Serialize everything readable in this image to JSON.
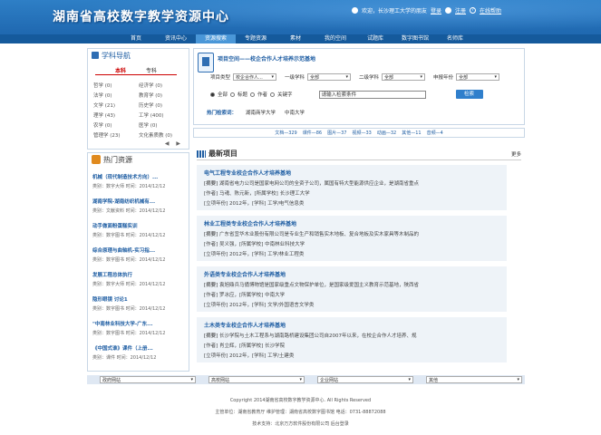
{
  "header": {
    "title": "湖南省高校数字教学资源中心",
    "welcome": "欢迎，长沙理工大学的朋友",
    "login": "登录",
    "register": "注册",
    "help": "在线帮助"
  },
  "nav": {
    "items": [
      "首页",
      "资讯中心",
      "资源搜索",
      "专题资源",
      "素材",
      "我的空间",
      "试题库",
      "数字图书馆",
      "名师库"
    ],
    "active": 2
  },
  "left_nav": {
    "title": "学科导航",
    "tabs": [
      "本科",
      "专科"
    ],
    "subjects": [
      "哲学 (0)",
      "经济学 (0)",
      "法学 (0)",
      "教育学 (0)",
      "文学 (21)",
      "历史学 (0)",
      "理学 (43)",
      "工学 (400)",
      "农学 (0)",
      "医学 (0)",
      "管理学 (23)",
      "文化素质教 (0)"
    ],
    "arrows": "◀ ▶"
  },
  "hot_resources": {
    "title": "热门资源",
    "items": [
      {
        "title": "机械（现代制造技术方向）...",
        "meta": "类别：数字大师  时间：2014/12/12"
      },
      {
        "title": "湖南学院-湖南纺织机械有...",
        "meta": "类别：文献资料  时间：2014/12/12"
      },
      {
        "title": "动手做面粉蛋糕实训",
        "meta": "类别：数字图书  时间：2014/12/12"
      },
      {
        "title": "综合原理与曲轴机-实习指...",
        "meta": "类别：数字图书  时间：2014/12/12"
      },
      {
        "title": "发展工程总体执行",
        "meta": "类别：数字大师  时间：2014/12/12"
      },
      {
        "title": "隐形眼镜 讨论1",
        "meta": "类别：数字图书  时间：2014/12/12"
      },
      {
        "title": "\"中南林业科技大学-广东...",
        "meta": "类别：数字图书  时间：2014/12/12"
      },
      {
        "title": "《中国式谁》课件（上册...",
        "meta": "类别：课件  时间：2014/12/12"
      }
    ]
  },
  "search": {
    "title": "项目空间——校企合作人才培养示范基地",
    "project_type_label": "项目类型",
    "project_type_value": "校企合作人...",
    "subject1_label": "一级学科",
    "subject1_value": "全部",
    "subject2_label": "二级学科",
    "subject2_value": "全部",
    "year_label": "申报年份",
    "year_value": "全部",
    "radios": [
      "全部",
      "标题",
      "作者",
      "关键字"
    ],
    "keyword_placeholder": "请输入检索条件",
    "button": "检索",
    "hot_label": "热门检索词：",
    "hot_words": [
      "湖南商学大学",
      "中南大学"
    ]
  },
  "stats": [
    "文档—329",
    "课件—86",
    "图片—37",
    "视频—33",
    "动画—32",
    "其他—11",
    "音频—4"
  ],
  "latest": {
    "title": "最新项目",
    "more": "更多",
    "items": [
      {
        "title": "电气工程专业校企合作人才培养基地",
        "summary": "湖南省电力公司是国家电网公司的全资子公司，属国有特大型能源供应企业，是湖南省重点",
        "author": "[作者] 马魂、陈元新，[所属学校] 长沙理工大学",
        "year": "[立项年份] 2012年，[学科] 工学/电气信息类"
      },
      {
        "title": "林业工程类专业校企合作人才培养基地",
        "summary": "广东省宜华木业股份有限公司是专业生产和销售实木地板、复合地板及实木家具等木制品的",
        "author": "[作者] 吴义强，[所属学校] 中南林业科技大学",
        "year": "[立项年份] 2012年，[学科] 工学/林业工程类"
      },
      {
        "title": "外语类专业校企合作人才培养基地",
        "summary": "袁旭鼎兵马俑博物馆是国家级重点文物保护单位，是国家级爱国主义教育示范基地，陕西省",
        "author": "[作者] 罗冰应，[所属学校] 中南大学",
        "year": "[立项年份] 2012年，[学科] 文学/外国语言文学类"
      },
      {
        "title": "土木类专业校企合作人才培养基地",
        "summary": "长沙学院与土木工程系与湖南路桥建设集团公司自2007年以来，在校企合作人才培养、规",
        "author": "[作者] 肖立辉，[所属学校] 长沙学院",
        "year": "[立项年份] 2012年，[学科] 工学/土建类"
      }
    ]
  },
  "link_bar": [
    "政府网站",
    "高校网站",
    "企业网站",
    "其他"
  ],
  "footer": {
    "copyright": "Copyright 2014湖南省高校数字教学资源中心. All Rights Reserved",
    "sponsor": "主管单位：湖南省教育厅  维护管理：湖南省高校数字图书馆  电话：0731-88872088",
    "support": "技术支持：北京万方软件股份有限公司",
    "admin": "后台登录"
  },
  "colors": {
    "header_blue": "#1f68b0",
    "nav_blue": "#155a9c",
    "link_blue": "#1f5ea3",
    "card_bg": "#eef3f8"
  }
}
